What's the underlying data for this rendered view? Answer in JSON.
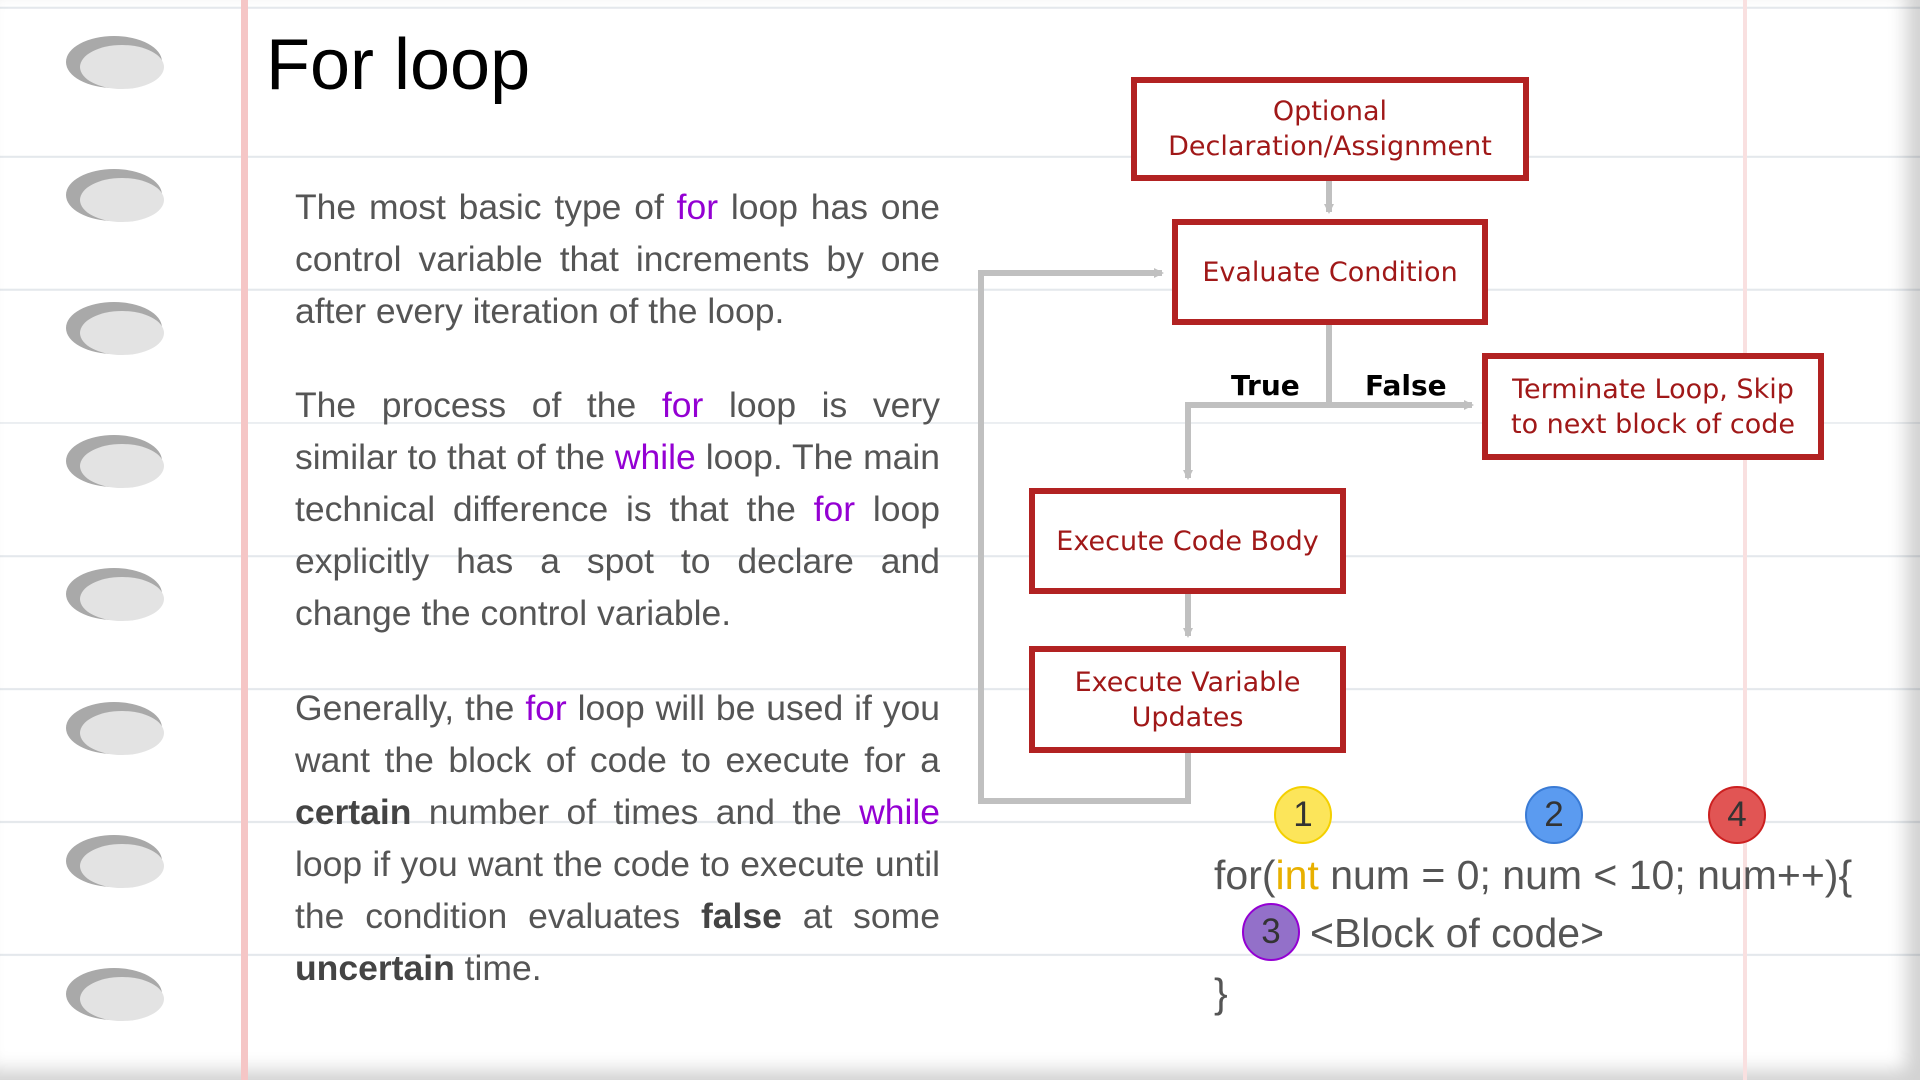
{
  "slide": {
    "title": "For loop"
  },
  "paragraphs": [
    {
      "segments": [
        {
          "text": "The most basic type of ",
          "style": "normal"
        },
        {
          "text": "for",
          "style": "keyword"
        },
        {
          "text": " loop has one control variable that increments by one after every iteration of the loop.",
          "style": "normal"
        }
      ]
    },
    {
      "segments": [
        {
          "text": "The process of the ",
          "style": "normal"
        },
        {
          "text": "for",
          "style": "keyword"
        },
        {
          "text": " loop is very similar to that of the ",
          "style": "normal"
        },
        {
          "text": "while",
          "style": "keyword"
        },
        {
          "text": " loop. The main technical difference is that the ",
          "style": "normal"
        },
        {
          "text": "for",
          "style": "keyword"
        },
        {
          "text": " loop explicitly has a spot to declare and change the control variable.",
          "style": "normal"
        }
      ]
    },
    {
      "segments": [
        {
          "text": "Generally, the ",
          "style": "normal"
        },
        {
          "text": "for",
          "style": "keyword"
        },
        {
          "text": " loop will be used if you want the block of code to execute for a ",
          "style": "normal"
        },
        {
          "text": "certain",
          "style": "bold"
        },
        {
          "text": " number of times and the ",
          "style": "normal"
        },
        {
          "text": "while",
          "style": "keyword"
        },
        {
          "text": " loop if you want the code to execute until the condition evaluates ",
          "style": "normal"
        },
        {
          "text": "false",
          "style": "bold"
        },
        {
          "text": " at some ",
          "style": "normal"
        },
        {
          "text": "uncertain",
          "style": "bold"
        },
        {
          "text": " time.",
          "style": "normal"
        }
      ]
    }
  ],
  "flowchart": {
    "declaration": "Optional\nDeclaration/Assignment",
    "condition": "Evaluate Condition",
    "true_label": "True",
    "false_label": "False",
    "terminate": "Terminate Loop, Skip\nto next block of code",
    "body": "Execute Code Body",
    "updates": "Execute Variable\nUpdates"
  },
  "code": {
    "line1_prefix": "for(",
    "line1_type": "int",
    "line1_rest": " num = 0; num < 10; num++){",
    "line2": "<Block of code>",
    "line3": "}"
  },
  "badges": {
    "b1": "1",
    "b2": "2",
    "b3": "3",
    "b4": "4"
  },
  "colors": {
    "keyword": "#9400d3",
    "box_border": "#b22222",
    "box_text": "#a01818",
    "arrow": "#c0c0c0",
    "type_keyword": "#e8b000",
    "badge1": "#fce55a",
    "badge2": "#5b9bf0",
    "badge3": "#9370c9",
    "badge4": "#e15554"
  }
}
